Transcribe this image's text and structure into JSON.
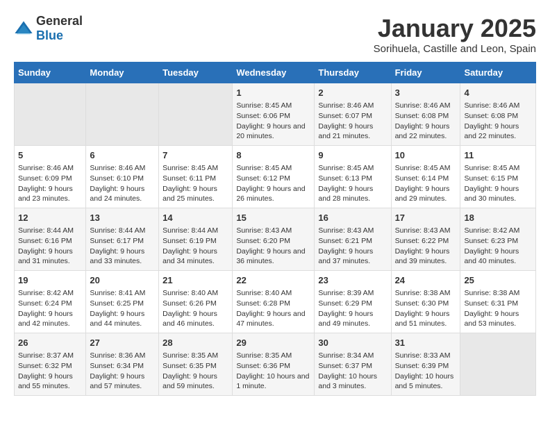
{
  "logo": {
    "general": "General",
    "blue": "Blue"
  },
  "title": "January 2025",
  "subtitle": "Sorihuela, Castille and Leon, Spain",
  "days_of_week": [
    "Sunday",
    "Monday",
    "Tuesday",
    "Wednesday",
    "Thursday",
    "Friday",
    "Saturday"
  ],
  "weeks": [
    [
      {
        "day": "",
        "sunrise": "",
        "sunset": "",
        "daylight": "",
        "empty": true
      },
      {
        "day": "",
        "sunrise": "",
        "sunset": "",
        "daylight": "",
        "empty": true
      },
      {
        "day": "",
        "sunrise": "",
        "sunset": "",
        "daylight": "",
        "empty": true
      },
      {
        "day": "1",
        "sunrise": "Sunrise: 8:45 AM",
        "sunset": "Sunset: 6:06 PM",
        "daylight": "Daylight: 9 hours and 20 minutes."
      },
      {
        "day": "2",
        "sunrise": "Sunrise: 8:46 AM",
        "sunset": "Sunset: 6:07 PM",
        "daylight": "Daylight: 9 hours and 21 minutes."
      },
      {
        "day": "3",
        "sunrise": "Sunrise: 8:46 AM",
        "sunset": "Sunset: 6:08 PM",
        "daylight": "Daylight: 9 hours and 22 minutes."
      },
      {
        "day": "4",
        "sunrise": "Sunrise: 8:46 AM",
        "sunset": "Sunset: 6:08 PM",
        "daylight": "Daylight: 9 hours and 22 minutes."
      }
    ],
    [
      {
        "day": "5",
        "sunrise": "Sunrise: 8:46 AM",
        "sunset": "Sunset: 6:09 PM",
        "daylight": "Daylight: 9 hours and 23 minutes."
      },
      {
        "day": "6",
        "sunrise": "Sunrise: 8:46 AM",
        "sunset": "Sunset: 6:10 PM",
        "daylight": "Daylight: 9 hours and 24 minutes."
      },
      {
        "day": "7",
        "sunrise": "Sunrise: 8:45 AM",
        "sunset": "Sunset: 6:11 PM",
        "daylight": "Daylight: 9 hours and 25 minutes."
      },
      {
        "day": "8",
        "sunrise": "Sunrise: 8:45 AM",
        "sunset": "Sunset: 6:12 PM",
        "daylight": "Daylight: 9 hours and 26 minutes."
      },
      {
        "day": "9",
        "sunrise": "Sunrise: 8:45 AM",
        "sunset": "Sunset: 6:13 PM",
        "daylight": "Daylight: 9 hours and 28 minutes."
      },
      {
        "day": "10",
        "sunrise": "Sunrise: 8:45 AM",
        "sunset": "Sunset: 6:14 PM",
        "daylight": "Daylight: 9 hours and 29 minutes."
      },
      {
        "day": "11",
        "sunrise": "Sunrise: 8:45 AM",
        "sunset": "Sunset: 6:15 PM",
        "daylight": "Daylight: 9 hours and 30 minutes."
      }
    ],
    [
      {
        "day": "12",
        "sunrise": "Sunrise: 8:44 AM",
        "sunset": "Sunset: 6:16 PM",
        "daylight": "Daylight: 9 hours and 31 minutes."
      },
      {
        "day": "13",
        "sunrise": "Sunrise: 8:44 AM",
        "sunset": "Sunset: 6:17 PM",
        "daylight": "Daylight: 9 hours and 33 minutes."
      },
      {
        "day": "14",
        "sunrise": "Sunrise: 8:44 AM",
        "sunset": "Sunset: 6:19 PM",
        "daylight": "Daylight: 9 hours and 34 minutes."
      },
      {
        "day": "15",
        "sunrise": "Sunrise: 8:43 AM",
        "sunset": "Sunset: 6:20 PM",
        "daylight": "Daylight: 9 hours and 36 minutes."
      },
      {
        "day": "16",
        "sunrise": "Sunrise: 8:43 AM",
        "sunset": "Sunset: 6:21 PM",
        "daylight": "Daylight: 9 hours and 37 minutes."
      },
      {
        "day": "17",
        "sunrise": "Sunrise: 8:43 AM",
        "sunset": "Sunset: 6:22 PM",
        "daylight": "Daylight: 9 hours and 39 minutes."
      },
      {
        "day": "18",
        "sunrise": "Sunrise: 8:42 AM",
        "sunset": "Sunset: 6:23 PM",
        "daylight": "Daylight: 9 hours and 40 minutes."
      }
    ],
    [
      {
        "day": "19",
        "sunrise": "Sunrise: 8:42 AM",
        "sunset": "Sunset: 6:24 PM",
        "daylight": "Daylight: 9 hours and 42 minutes."
      },
      {
        "day": "20",
        "sunrise": "Sunrise: 8:41 AM",
        "sunset": "Sunset: 6:25 PM",
        "daylight": "Daylight: 9 hours and 44 minutes."
      },
      {
        "day": "21",
        "sunrise": "Sunrise: 8:40 AM",
        "sunset": "Sunset: 6:26 PM",
        "daylight": "Daylight: 9 hours and 46 minutes."
      },
      {
        "day": "22",
        "sunrise": "Sunrise: 8:40 AM",
        "sunset": "Sunset: 6:28 PM",
        "daylight": "Daylight: 9 hours and 47 minutes."
      },
      {
        "day": "23",
        "sunrise": "Sunrise: 8:39 AM",
        "sunset": "Sunset: 6:29 PM",
        "daylight": "Daylight: 9 hours and 49 minutes."
      },
      {
        "day": "24",
        "sunrise": "Sunrise: 8:38 AM",
        "sunset": "Sunset: 6:30 PM",
        "daylight": "Daylight: 9 hours and 51 minutes."
      },
      {
        "day": "25",
        "sunrise": "Sunrise: 8:38 AM",
        "sunset": "Sunset: 6:31 PM",
        "daylight": "Daylight: 9 hours and 53 minutes."
      }
    ],
    [
      {
        "day": "26",
        "sunrise": "Sunrise: 8:37 AM",
        "sunset": "Sunset: 6:32 PM",
        "daylight": "Daylight: 9 hours and 55 minutes."
      },
      {
        "day": "27",
        "sunrise": "Sunrise: 8:36 AM",
        "sunset": "Sunset: 6:34 PM",
        "daylight": "Daylight: 9 hours and 57 minutes."
      },
      {
        "day": "28",
        "sunrise": "Sunrise: 8:35 AM",
        "sunset": "Sunset: 6:35 PM",
        "daylight": "Daylight: 9 hours and 59 minutes."
      },
      {
        "day": "29",
        "sunrise": "Sunrise: 8:35 AM",
        "sunset": "Sunset: 6:36 PM",
        "daylight": "Daylight: 10 hours and 1 minute."
      },
      {
        "day": "30",
        "sunrise": "Sunrise: 8:34 AM",
        "sunset": "Sunset: 6:37 PM",
        "daylight": "Daylight: 10 hours and 3 minutes."
      },
      {
        "day": "31",
        "sunrise": "Sunrise: 8:33 AM",
        "sunset": "Sunset: 6:39 PM",
        "daylight": "Daylight: 10 hours and 5 minutes."
      },
      {
        "day": "",
        "sunrise": "",
        "sunset": "",
        "daylight": "",
        "empty": true
      }
    ]
  ]
}
